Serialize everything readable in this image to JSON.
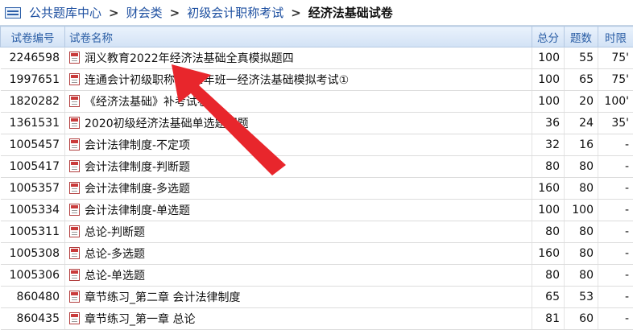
{
  "breadcrumb": {
    "items": [
      "公共题库中心",
      "财会类",
      "初级会计职称考试"
    ],
    "separator": ">",
    "current": "经济法基础试卷"
  },
  "table": {
    "headers": {
      "id": "试卷编号",
      "name": "试卷名称",
      "score": "总分",
      "count": "题数",
      "time": "时限"
    },
    "rows": [
      {
        "id": "2246598",
        "name": "润义教育2022年经济法基础全真模拟题四",
        "score": "100",
        "count": "55",
        "time": "75'"
      },
      {
        "id": "1997651",
        "name": "连通会计初级职称2022年班一经济法基础模拟考试①",
        "score": "100",
        "count": "65",
        "time": "75'"
      },
      {
        "id": "1820282",
        "name": "《经济法基础》补考试卷",
        "score": "100",
        "count": "20",
        "time": "100'"
      },
      {
        "id": "1361531",
        "name": "2020初级经济法基础单选题押题",
        "score": "36",
        "count": "24",
        "time": "35'"
      },
      {
        "id": "1005457",
        "name": "会计法律制度-不定项",
        "score": "32",
        "count": "16",
        "time": "-"
      },
      {
        "id": "1005417",
        "name": "会计法律制度-判断题",
        "score": "80",
        "count": "80",
        "time": "-"
      },
      {
        "id": "1005357",
        "name": "会计法律制度-多选题",
        "score": "160",
        "count": "80",
        "time": "-"
      },
      {
        "id": "1005334",
        "name": "会计法律制度-单选题",
        "score": "100",
        "count": "100",
        "time": "-"
      },
      {
        "id": "1005311",
        "name": "总论-判断题",
        "score": "80",
        "count": "80",
        "time": "-"
      },
      {
        "id": "1005308",
        "name": "总论-多选题",
        "score": "160",
        "count": "80",
        "time": "-"
      },
      {
        "id": "1005306",
        "name": "总论-单选题",
        "score": "80",
        "count": "80",
        "time": "-"
      },
      {
        "id": "860480",
        "name": "章节练习_第二章 会计法律制度",
        "score": "65",
        "count": "53",
        "time": "-"
      },
      {
        "id": "860435",
        "name": "章节练习_第一章 总论",
        "score": "81",
        "count": "60",
        "time": "-"
      }
    ]
  },
  "colors": {
    "link": "#1d4fa0",
    "header_text": "#2c5fa6",
    "arrow": "#e8262c"
  },
  "icons": {
    "breadcrumb": "list-icon",
    "row": "document-icon",
    "annotation": "red-arrow"
  }
}
